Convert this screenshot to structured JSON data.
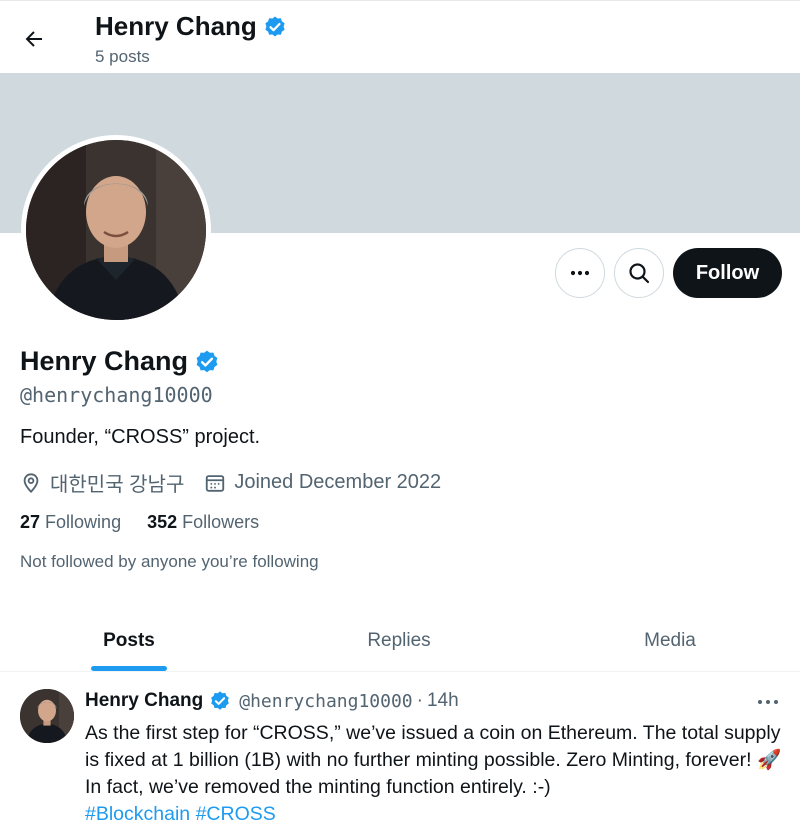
{
  "header": {
    "name": "Henry Chang",
    "post_count": "5 posts"
  },
  "actions": {
    "follow_label": "Follow"
  },
  "profile": {
    "name": "Henry Chang",
    "handle": "@henrychang10000",
    "bio": "Founder, “CROSS” project.",
    "location": "대한민국 강남구",
    "joined": "Joined December 2022",
    "following_count": "27",
    "following_label": "Following",
    "followers_count": "352",
    "followers_label": "Followers",
    "not_followed_text": "Not followed by anyone you’re following"
  },
  "tabs": [
    {
      "label": "Posts",
      "active": true
    },
    {
      "label": "Replies",
      "active": false
    },
    {
      "label": "Media",
      "active": false
    }
  ],
  "post": {
    "name": "Henry Chang",
    "handle": "@henrychang10000",
    "dot": "·",
    "time": "14h",
    "text_part1": "As the first step for “CROSS,” we’ve issued a coin on Ethereum. The total supply is fixed at 1 billion (1B) with no further minting possible. Zero Minting, forever!",
    "emoji": "🚀",
    "text_part2": " In fact, we’ve removed the minting function entirely. :-)",
    "hashtag1": "#Blockchain",
    "hashtag2": "#CROSS"
  },
  "colors": {
    "accent": "#1d9bf0",
    "banner": "#cfd9de",
    "text": "#0f1419",
    "muted": "#536471"
  },
  "icons": [
    "back-arrow-icon",
    "verified-badge-icon",
    "more-icon",
    "search-icon",
    "location-pin-icon",
    "calendar-icon"
  ]
}
